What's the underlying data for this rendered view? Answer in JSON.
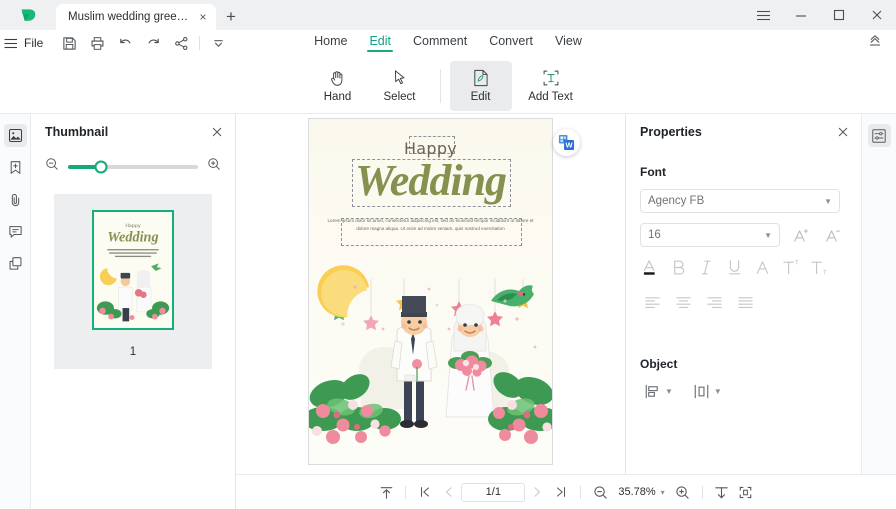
{
  "window": {
    "tab_title": "Muslim wedding greetin...",
    "tab_close": "×",
    "new_tab": "+",
    "menu_icon": "hamburger-menu-icon",
    "minimize": "—",
    "maximize": "□",
    "close": "×"
  },
  "menubar": {
    "file_label": "File",
    "quick_access": [
      {
        "name": "save-icon",
        "tooltip": "Save"
      },
      {
        "name": "print-icon",
        "tooltip": "Print"
      },
      {
        "name": "undo-icon",
        "tooltip": "Undo"
      },
      {
        "name": "redo-icon",
        "tooltip": "Redo"
      },
      {
        "name": "share-icon",
        "tooltip": "Share"
      },
      {
        "name": "more-options-icon",
        "tooltip": "More"
      }
    ]
  },
  "ribbon": {
    "tabs": [
      {
        "label": "Home",
        "active": false
      },
      {
        "label": "Edit",
        "active": true
      },
      {
        "label": "Comment",
        "active": false
      },
      {
        "label": "Convert",
        "active": false
      },
      {
        "label": "View",
        "active": false
      }
    ],
    "collapse_icon": "collapse-ribbon-icon",
    "tools": [
      {
        "label": "Hand",
        "icon": "hand-icon",
        "active": false
      },
      {
        "label": "Select",
        "icon": "cursor-arrow-icon",
        "active": false
      },
      {
        "label": "Edit",
        "icon": "edit-page-icon",
        "active": true
      },
      {
        "label": "Add Text",
        "icon": "add-text-icon",
        "active": false
      }
    ]
  },
  "left_rail": [
    {
      "name": "thumbnail-panel-icon",
      "active": true
    },
    {
      "name": "bookmark-add-icon",
      "active": false
    },
    {
      "name": "attachment-paperclip-icon",
      "active": false
    },
    {
      "name": "comment-bubble-icon",
      "active": false
    },
    {
      "name": "layers-icon",
      "active": false
    }
  ],
  "thumbnail_panel": {
    "title": "Thumbnail",
    "close_label": "×",
    "zoom_out_icon": "zoom-out-icon",
    "zoom_in_icon": "zoom-in-icon",
    "slider_percent": 25,
    "pages": [
      {
        "number": "1",
        "selected": true
      }
    ]
  },
  "document": {
    "heading_small": "Happy",
    "heading_large": "Wedding",
    "body_text": "Lorem ipsum dolor sit amet, consectetur adipiscing elit, sed do eiusmod tempor incididunt ut labore et dolore magna aliqua. Ut enim ad minim veniam, quis nostrud exercitation",
    "convert_badge_icon": "convert-to-word-icon",
    "page_background": "#fdfcf2",
    "heading_color": "#869150"
  },
  "properties_panel": {
    "title": "Properties",
    "close_label": "×",
    "font_section_label": "Font",
    "font_family": "Agency FB",
    "font_size": "16",
    "increase_font_icon": "increase-font-size-icon",
    "decrease_font_icon": "decrease-font-size-icon",
    "format_buttons": [
      {
        "name": "font-color-icon",
        "glyph": "A"
      },
      {
        "name": "bold-icon",
        "glyph": "B"
      },
      {
        "name": "italic-icon",
        "glyph": "I"
      },
      {
        "name": "underline-icon",
        "glyph": "U"
      },
      {
        "name": "strikethrough-icon",
        "glyph": "A"
      },
      {
        "name": "superscript-icon",
        "glyph": "T"
      },
      {
        "name": "subscript-icon",
        "glyph": "T"
      }
    ],
    "align_buttons": [
      {
        "name": "align-left-icon"
      },
      {
        "name": "align-center-icon"
      },
      {
        "name": "align-right-icon"
      },
      {
        "name": "align-justify-icon"
      }
    ],
    "object_section_label": "Object",
    "object_buttons": [
      {
        "name": "align-objects-icon"
      },
      {
        "name": "distribute-objects-icon"
      }
    ]
  },
  "right_rail": [
    {
      "name": "properties-panel-icon",
      "active": true
    }
  ],
  "statusbar": {
    "fit_top_icon": "scroll-to-top-icon",
    "first_page_icon": "first-page-icon",
    "prev_page_icon": "previous-page-icon",
    "page_indicator": "1/1",
    "next_page_icon": "next-page-icon",
    "last_page_icon": "last-page-icon",
    "zoom_out_icon": "zoom-out-icon",
    "zoom_level": "35.78%",
    "zoom_caret": "▾",
    "zoom_in_icon": "zoom-in-icon",
    "fit_width_icon": "fit-width-icon",
    "fit_page_icon": "fit-page-icon"
  },
  "theme": {
    "accent_green": "#14a97a",
    "tab_active_green": "#16a085",
    "titlebar_bg": "#eef0f2",
    "panel_border": "#e3e6e9"
  }
}
